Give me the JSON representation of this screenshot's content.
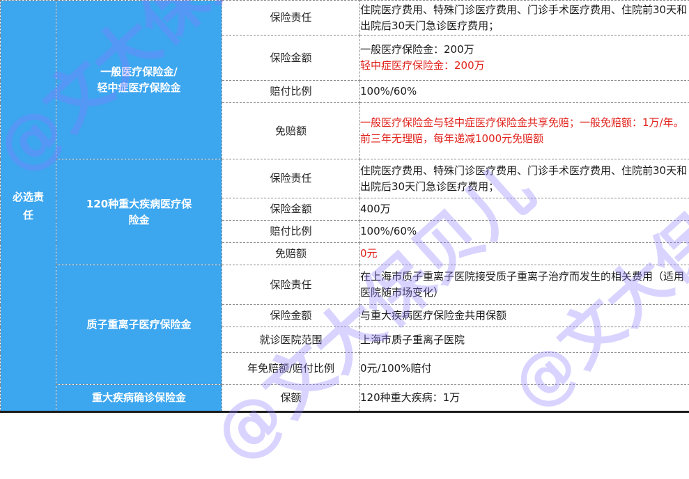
{
  "category": "必选责任",
  "sections": [
    {
      "name": "一般医疗保险金/\n轻中症医疗保险金",
      "rows": [
        {
          "label": "保险责任",
          "lines": [
            {
              "text": "住院医疗费用、特殊门诊医疗费用、门诊手术医疗费用、住院前30天和出院后30天门急诊医疗费用；",
              "color": "#1a1a1a"
            }
          ]
        },
        {
          "label": "保险金额",
          "lines": [
            {
              "text": "一般医疗保险金：200万",
              "color": "#1a1a1a"
            },
            {
              "text": "轻中症医疗保险金：200万",
              "color": "#e0221b"
            }
          ]
        },
        {
          "label": "赔付比例",
          "lines": [
            {
              "text": "100%/60%",
              "color": "#1a1a1a"
            }
          ]
        },
        {
          "label": "免赔额",
          "lines": [
            {
              "text": "一般医疗保险金与轻中症医疗保险金共享免赔；一般免赔额：1万/年。",
              "color": "#e0221b"
            },
            {
              "text": "前三年无理赔，每年递减1000元免赔额",
              "color": "#e0221b"
            }
          ]
        }
      ]
    },
    {
      "name": "120种重大疾病医疗保\n险金",
      "rows": [
        {
          "label": "保险责任",
          "lines": [
            {
              "text": "住院医疗费用、特殊门诊医疗费用、门诊手术医疗费用、住院前30天和出院后30天门急诊医疗费用；",
              "color": "#1a1a1a"
            }
          ]
        },
        {
          "label": "保险金额",
          "lines": [
            {
              "text": "400万",
              "color": "#1a1a1a"
            }
          ]
        },
        {
          "label": "赔付比例",
          "lines": [
            {
              "text": "100%/60%",
              "color": "#1a1a1a"
            }
          ]
        },
        {
          "label": "免赔额",
          "lines": [
            {
              "text": "0元",
              "color": "#e0221b"
            }
          ]
        }
      ]
    },
    {
      "name": "质子重离子医疗保险金",
      "rows": [
        {
          "label": "保险责任",
          "lines": [
            {
              "text": "在上海市质子重离子医院接受质子重离子治疗而发生的相关费用（适用医院随市场变化）",
              "color": "#1a1a1a"
            }
          ]
        },
        {
          "label": "保险金额",
          "lines": [
            {
              "text": "与重大疾病医疗保险金共用保额",
              "color": "#1a1a1a"
            }
          ]
        },
        {
          "label": "就诊医院范围",
          "lines": [
            {
              "text": "上海市质子重离子医院",
              "color": "#1a1a1a"
            }
          ]
        },
        {
          "label": "年免赔额/赔付比例",
          "lines": [
            {
              "text": "0元/100%赔付",
              "color": "#1a1a1a"
            }
          ]
        }
      ]
    },
    {
      "name": "重大疾病确诊保险金",
      "rows": [
        {
          "label": "保额",
          "lines": [
            {
              "text": "120种重大疾病：1万",
              "color": "#1a1a1a"
            }
          ]
        }
      ]
    }
  ],
  "watermark": {
    "text": "@文大保贝儿",
    "color": "#897aff"
  }
}
